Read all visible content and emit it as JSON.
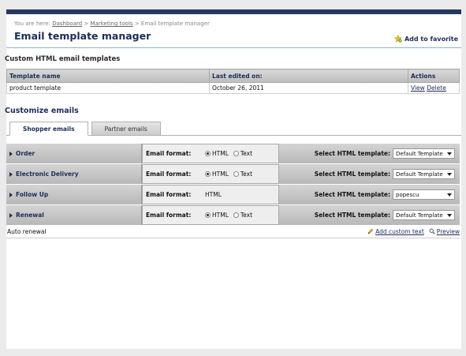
{
  "breadcrumb": {
    "prefix": "You are here:",
    "items": [
      "Dashboard",
      "Marketing tools"
    ],
    "current": "Email template manager",
    "separator": ">"
  },
  "page": {
    "title": "Email template manager",
    "favorite_label": "Add to favorite"
  },
  "custom_templates": {
    "section_title": "Custom HTML email templates",
    "columns": [
      "Template name",
      "Last edited on:",
      "Actions"
    ],
    "rows": [
      {
        "name": "product template",
        "edited": "October 26, 2011",
        "view": "View",
        "delete": "Delete"
      }
    ]
  },
  "customize": {
    "section_title": "Customize emails",
    "tabs": [
      {
        "label": "Shopper emails",
        "active": true
      },
      {
        "label": "Partner emails",
        "active": false
      }
    ],
    "format_label": "Email format:",
    "template_label": "Select HTML template:",
    "html_option": "HTML",
    "text_option": "Text",
    "rows": [
      {
        "name": "Order",
        "format": "radio",
        "selected_format": "HTML",
        "template": "Default Template"
      },
      {
        "name": "Electronic Delivery",
        "format": "radio",
        "selected_format": "HTML",
        "template": "Default Template"
      },
      {
        "name": "Follow Up",
        "format": "static",
        "format_value": "HTML",
        "template": "popescu"
      },
      {
        "name": "Renewal",
        "format": "radio",
        "selected_format": "HTML",
        "template": "Default Template"
      }
    ]
  },
  "footer": {
    "auto_renewal": "Auto renewal",
    "add_custom_text": "Add custom text",
    "preview": "Preview"
  },
  "colors": {
    "brand_navy": "#1c2d57",
    "top_bar": "#26395e",
    "favorite_star": "#e8b923"
  },
  "icons": [
    "star-icon",
    "pencil-icon",
    "magnifier-icon",
    "triangle-right-icon",
    "dropdown-caret-icon"
  ]
}
